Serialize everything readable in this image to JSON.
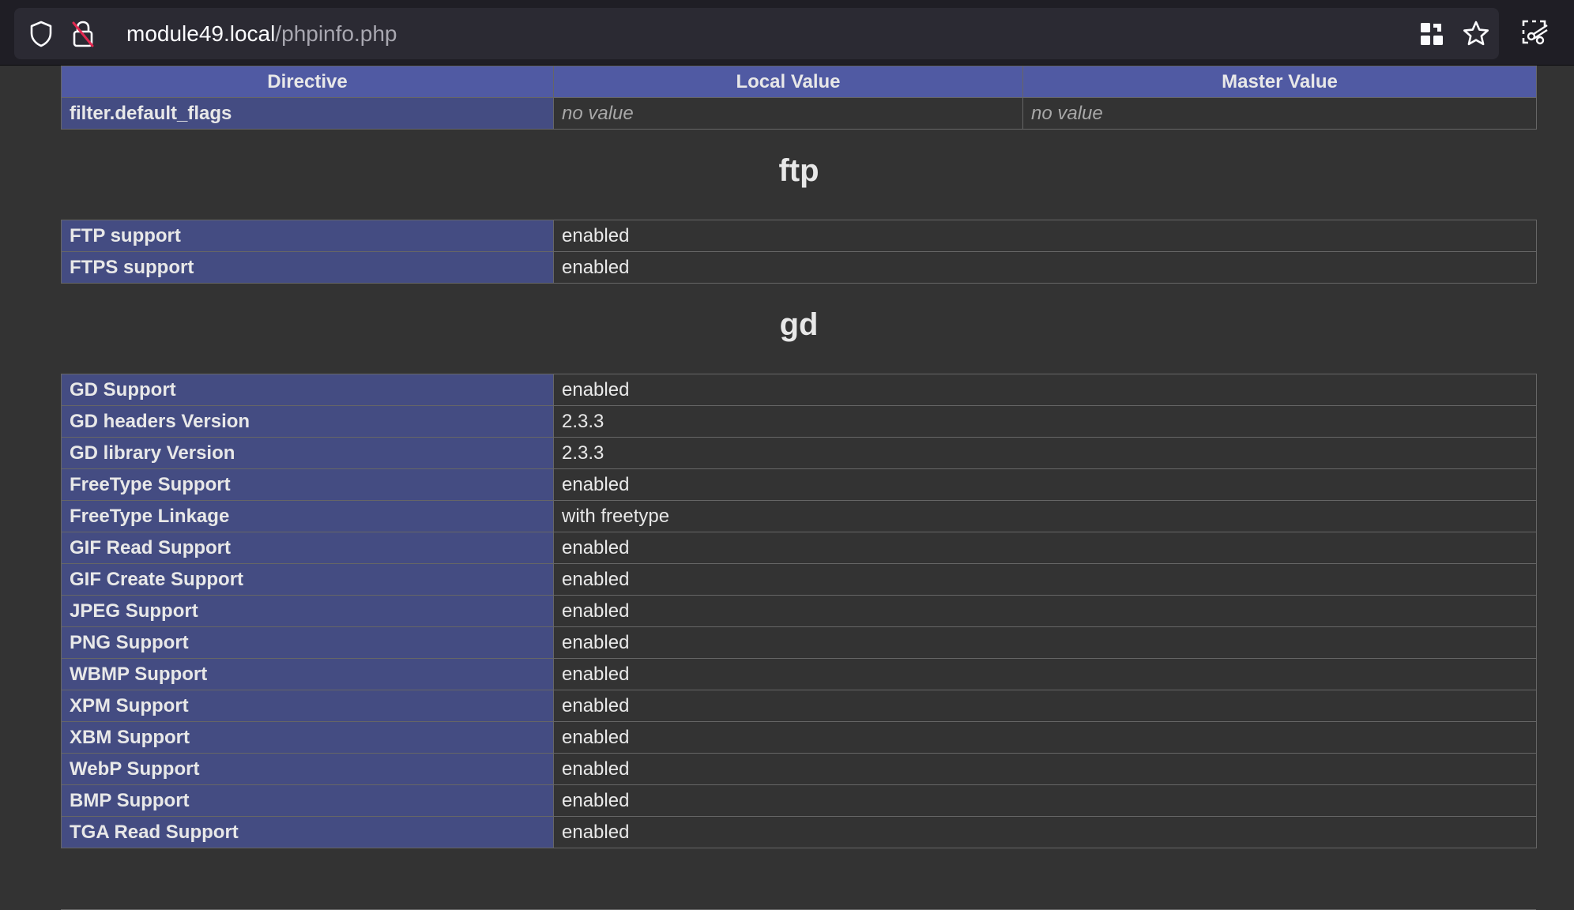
{
  "browser": {
    "url_host": "module49.local",
    "url_path": "/phpinfo.php",
    "icons": [
      "shield-icon",
      "insecure-lock-icon",
      "qr-code-icon",
      "bookmark-star-icon",
      "screenshot-icon"
    ]
  },
  "filter_table": {
    "headers": [
      "Directive",
      "Local Value",
      "Master Value"
    ],
    "rows": [
      {
        "name": "filter.default_flags",
        "local": "no value",
        "master": "no value"
      }
    ]
  },
  "ftp": {
    "title": "ftp",
    "rows": [
      {
        "name": "FTP support",
        "value": "enabled"
      },
      {
        "name": "FTPS support",
        "value": "enabled"
      }
    ]
  },
  "gd": {
    "title": "gd",
    "rows": [
      {
        "name": "GD Support",
        "value": "enabled"
      },
      {
        "name": "GD headers Version",
        "value": "2.3.3"
      },
      {
        "name": "GD library Version",
        "value": "2.3.3"
      },
      {
        "name": "FreeType Support",
        "value": "enabled"
      },
      {
        "name": "FreeType Linkage",
        "value": "with freetype"
      },
      {
        "name": "GIF Read Support",
        "value": "enabled"
      },
      {
        "name": "GIF Create Support",
        "value": "enabled"
      },
      {
        "name": "JPEG Support",
        "value": "enabled"
      },
      {
        "name": "PNG Support",
        "value": "enabled"
      },
      {
        "name": "WBMP Support",
        "value": "enabled"
      },
      {
        "name": "XPM Support",
        "value": "enabled"
      },
      {
        "name": "XBM Support",
        "value": "enabled"
      },
      {
        "name": "WebP Support",
        "value": "enabled"
      },
      {
        "name": "BMP Support",
        "value": "enabled"
      },
      {
        "name": "TGA Read Support",
        "value": "enabled"
      }
    ]
  },
  "colors": {
    "header_bg": "#505aa3",
    "directive_bg": "#444c82",
    "value_bg": "#333333",
    "toolbar_bg": "#1f1e25"
  }
}
